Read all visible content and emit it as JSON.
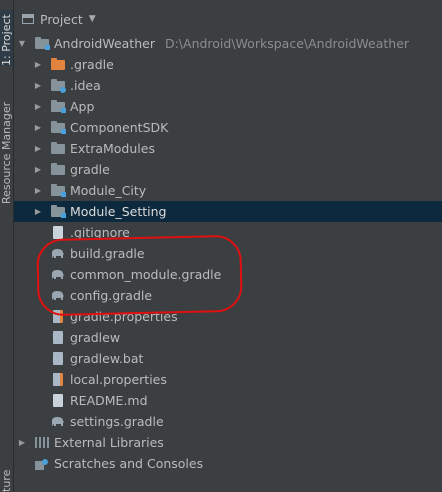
{
  "sidebar": {
    "project_tab": "1: Project",
    "resource_tab": "Resource Manager",
    "structure_tab": "ture"
  },
  "header": {
    "title": "Project",
    "dropdown_icon": "chevron-down-icon"
  },
  "tree": {
    "root": {
      "name": "AndroidWeather",
      "path": "D:\\Android\\Workspace\\AndroidWeather"
    },
    "items": [
      {
        "label": ".gradle"
      },
      {
        "label": ".idea"
      },
      {
        "label": "App"
      },
      {
        "label": "ComponentSDK"
      },
      {
        "label": "ExtraModules"
      },
      {
        "label": "gradle"
      },
      {
        "label": "Module_City"
      },
      {
        "label": "Module_Setting"
      },
      {
        "label": ".gitignore"
      },
      {
        "label": "build.gradle"
      },
      {
        "label": "common_module.gradle"
      },
      {
        "label": "config.gradle"
      },
      {
        "label": "gradle.properties"
      },
      {
        "label": "gradlew"
      },
      {
        "label": "gradlew.bat"
      },
      {
        "label": "local.properties"
      },
      {
        "label": "README.md"
      },
      {
        "label": "settings.gradle"
      }
    ],
    "external_libraries": "External Libraries",
    "scratches": "Scratches and Consoles"
  },
  "colors": {
    "background": "#3c3f41",
    "selection": "#0d293e",
    "annotation": "#e01010",
    "folder_orange": "#e2843e",
    "text": "#bbbbbb"
  }
}
